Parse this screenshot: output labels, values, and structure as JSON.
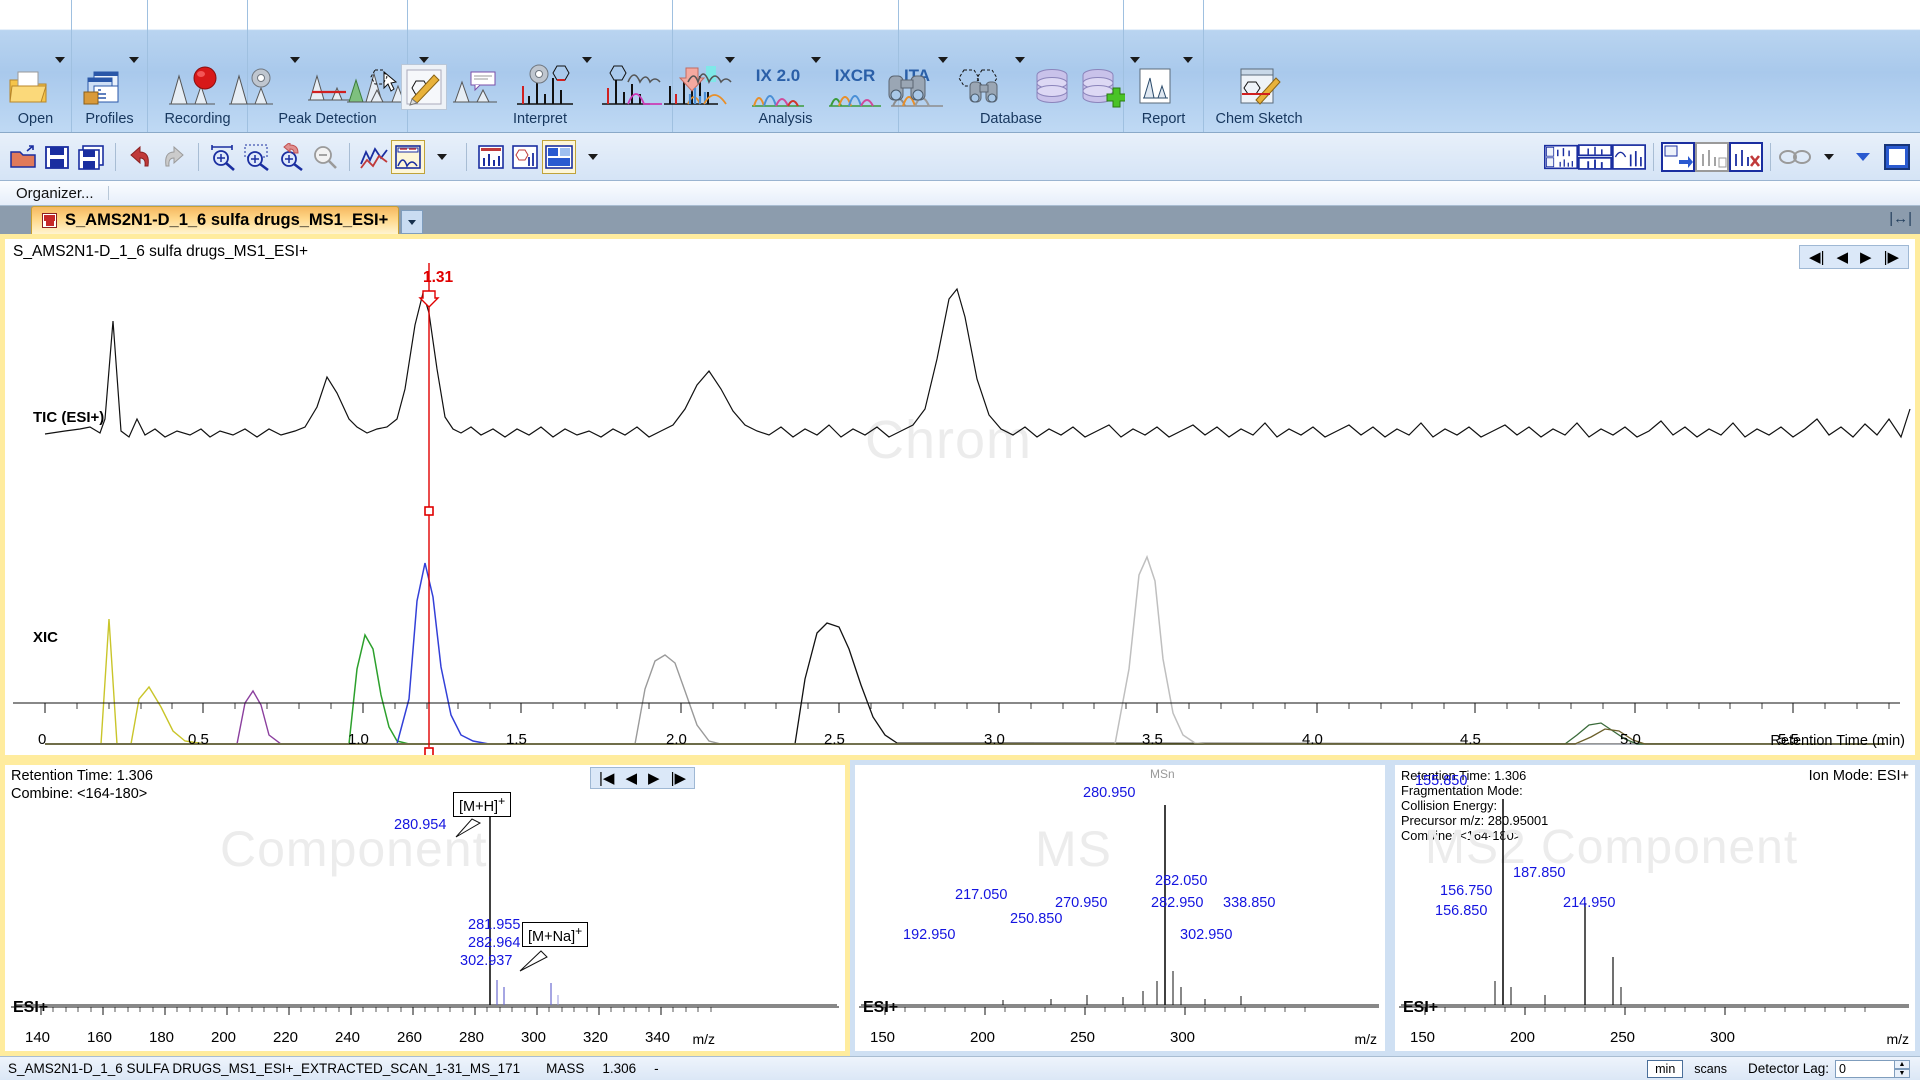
{
  "ribbon": {
    "groups": [
      {
        "label": "Open",
        "icons": [
          "folder-open-icon"
        ],
        "dropdowns": 1
      },
      {
        "label": "Profiles",
        "icons": [
          "profiles-icon"
        ],
        "dropdowns": 1
      },
      {
        "label": "Recording",
        "icons": [
          "recording-icon"
        ],
        "dropdowns": 0
      },
      {
        "label": "Peak Detection",
        "icons": [
          "peak-detection-settings-icon",
          "peak-baseline-icon",
          "peak-pick-cursor-icon"
        ],
        "dropdowns": 2
      },
      {
        "label": "Interpret",
        "icons": [
          "structure-peak-icon",
          "structure-edit-icon",
          "annotate-icon",
          "spectrum-settings-icon",
          "spectrum-fragment-icon",
          "fragment-assign-icon"
        ],
        "dropdowns": 2
      },
      {
        "label": "Analysis",
        "icons": [
          "chrom-compare-icon",
          "ix20-icon",
          "ixcr-icon",
          "ita-icon"
        ],
        "dropdowns": 1,
        "texts": [
          "IX 2.0",
          "IXCR",
          "ITA"
        ]
      },
      {
        "label": "Database",
        "icons": [
          "search-binoculars-icon",
          "structure-search-icon",
          "database-icon",
          "database-add-icon"
        ],
        "dropdowns": 3
      },
      {
        "label": "Report",
        "icons": [
          "report-icon"
        ],
        "dropdowns": 1
      },
      {
        "label": "Chem Sketch",
        "icons": [
          "chemsketch-icon"
        ],
        "dropdowns": 0
      }
    ]
  },
  "toolbar2": {
    "buttons": [
      "open-file-icon",
      "save-icon",
      "save-all-icon",
      "undo-icon",
      "redo-icon",
      "zoom-horizontal-icon",
      "zoom-box-icon",
      "zoom-undo-icon",
      "zoom-out-icon",
      "trace-overlay-icon",
      "chrom-view-icon",
      "chrom-view-dropdown-icon",
      "spectrum-view-icon",
      "spectrum-structure-icon",
      "layout-view-icon",
      "layout-dropdown-icon"
    ],
    "right_buttons": [
      "multi-pane-layout-icon",
      "stacked-spectra-icon",
      "component-spectra-icon",
      "export-right-icon",
      "export-spectrum-icon",
      "export-delete-icon",
      "link-traces-icon",
      "link-dropdown-icon",
      "panel-dropdown-icon",
      "maximize-pane-icon"
    ]
  },
  "organizer": {
    "label": "Organizer..."
  },
  "tab": {
    "title": "S_AMS2N1-D_1_6 sulfa drugs_MS1_ESI+",
    "dropdown": "▾"
  },
  "chromatogram": {
    "title": "S_AMS2N1-D_1_6 sulfa drugs_MS1_ESI+",
    "watermark": "Chrom",
    "trace_labels": [
      "TIC (ESI+)",
      "XIC"
    ],
    "cursor_label": "1.31",
    "x_caption": "Retention Time (min)",
    "nav": [
      "◀|",
      "◀",
      "▶",
      "|▶"
    ],
    "xticks": [
      "0",
      "0.5",
      "1.0",
      "1.5",
      "2.0",
      "2.5",
      "3.0",
      "3.5",
      "4.0",
      "4.5",
      "5.0",
      "5.5"
    ]
  },
  "component_panel": {
    "watermark": "Component",
    "retention_time_label": "Retention Time:",
    "retention_time_value": "1.306",
    "combine_label": "Combine:",
    "combine_value": "<164-180>",
    "ion_mode": "ESI+",
    "x_caption": "m/z",
    "xticks": [
      "140",
      "160",
      "180",
      "200",
      "220",
      "240",
      "260",
      "280",
      "300",
      "320",
      "340"
    ],
    "nav": [
      "|◀",
      "◀",
      "▶",
      "|▶"
    ],
    "peaks": [
      {
        "mz": "280.954",
        "label": "[M+H]",
        "charge": "+"
      },
      {
        "mz": "281.955"
      },
      {
        "mz": "282.964"
      },
      {
        "mz": "302.937",
        "label": "[M+Na]",
        "charge": "+"
      }
    ]
  },
  "ms_panel": {
    "watermark": "MS",
    "msn_marker": "MSn",
    "ion_mode": "ESI+",
    "x_caption": "m/z",
    "xticks": [
      "150",
      "200",
      "250",
      "300"
    ],
    "peaks": [
      "192.950",
      "217.050",
      "250.850",
      "270.950",
      "280.950",
      "282.050",
      "282.950",
      "338.850",
      "302.950"
    ]
  },
  "ms2_panel": {
    "watermark": "MS2 Component",
    "ion_mode_label": "Ion Mode: ESI+",
    "meta": [
      "Retention Time: 1.306",
      "Fragmentation Mode:",
      "Collision Energy:",
      "Precursor m/z: 280.95001",
      "Combine: <164-180>"
    ],
    "esi": "ESI+",
    "x_caption": "m/z",
    "xticks": [
      "150",
      "200",
      "250",
      "300"
    ],
    "peaks": [
      "155.850",
      "156.750",
      "156.850",
      "187.850",
      "214.950"
    ]
  },
  "status_bar": {
    "file": "S_AMS2N1-D_1_6 SULFA DRUGS_MS1_ESI+_EXTRACTED_SCAN_1-31_MS_171",
    "mass_label": "MASS",
    "mass_value": "1.306",
    "dash": "-",
    "unit_min": "min",
    "unit_scans": "scans",
    "detector_lag_label": "Detector Lag:",
    "detector_lag_value": "0"
  },
  "colors": {
    "ribbon_blue": "#a9c9ec",
    "tab_orange": "#ffd88a",
    "cursor_red": "#e00000",
    "peak_label_blue": "#1414e0",
    "panel_border_yellow": "#ffec9e"
  }
}
